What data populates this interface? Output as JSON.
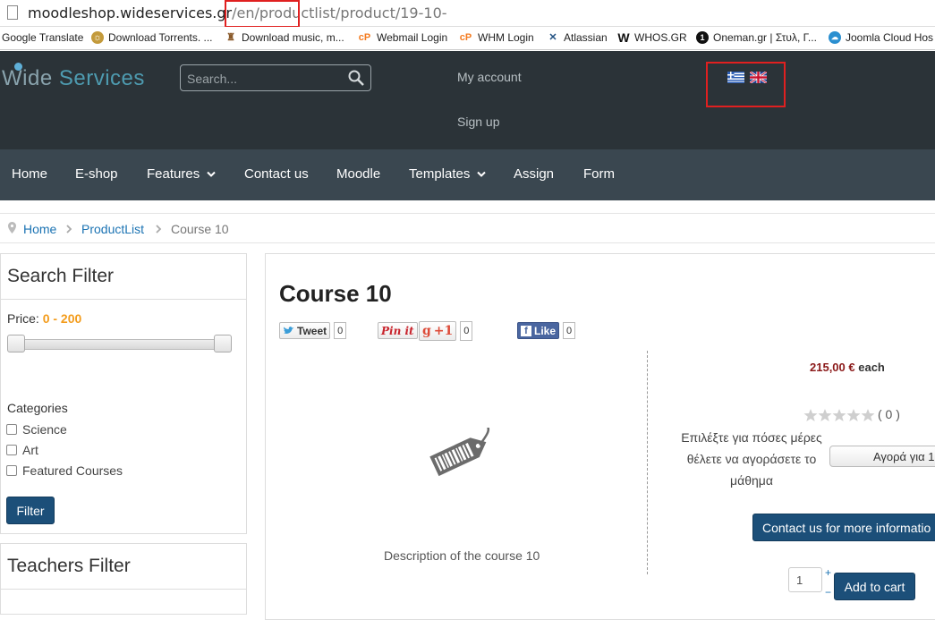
{
  "browser": {
    "url_host": "moodleshop.wideservices.gr",
    "url_path": "/en/productlist/product/19-10-",
    "bookmarks": [
      {
        "label": "Google Translate",
        "icon": "google-translate-icon"
      },
      {
        "label": "Download Torrents. ...",
        "icon": "torrent-icon"
      },
      {
        "label": "Download music, m...",
        "icon": "music-icon"
      },
      {
        "label": "Webmail Login",
        "icon": "cpanel-icon"
      },
      {
        "label": "WHM Login",
        "icon": "cpanel-icon"
      },
      {
        "label": "Atlassian",
        "icon": "atlassian-icon"
      },
      {
        "label": "WHOS.GR",
        "icon": "whos-icon"
      },
      {
        "label": "Oneman.gr | Στυλ, Γ...",
        "icon": "oneman-icon"
      },
      {
        "label": "Joomla Cloud Hos",
        "icon": "cloud-icon"
      }
    ]
  },
  "header": {
    "logo_word1": "Wide",
    "logo_word2": "Services",
    "search_placeholder": "Search...",
    "my_account": "My account",
    "sign_up": "Sign up",
    "languages": [
      "greek-flag-icon",
      "uk-flag-icon"
    ]
  },
  "nav": {
    "items": [
      {
        "label": "Home",
        "dropdown": false
      },
      {
        "label": "E-shop",
        "dropdown": false
      },
      {
        "label": "Features",
        "dropdown": true
      },
      {
        "label": "Contact us",
        "dropdown": false
      },
      {
        "label": "Moodle",
        "dropdown": false
      },
      {
        "label": "Templates",
        "dropdown": true
      },
      {
        "label": "Assign",
        "dropdown": false
      },
      {
        "label": "Form",
        "dropdown": false
      }
    ]
  },
  "breadcrumb": {
    "home": "Home",
    "productlist": "ProductList",
    "current": "Course 10"
  },
  "search_filter": {
    "title": "Search Filter",
    "price_label": "Price:",
    "price_range": "0 - 200",
    "price_min": 0,
    "price_max": 200,
    "categories_label": "Categories",
    "categories": [
      "Science",
      "Art",
      "Featured Courses"
    ],
    "filter_button": "Filter"
  },
  "teachers_filter": {
    "title": "Teachers Filter"
  },
  "product": {
    "title": "Course 10",
    "tweet_label": "Tweet",
    "tweet_count": "0",
    "pinit_label": "Pin it",
    "gplus_label": "+1",
    "gplus_count": "0",
    "like_label": "Like",
    "like_count": "0",
    "description": "Description of the course 10",
    "price_amount": "215,00 €",
    "price_suffix": "each",
    "rating_text": "( 0 )",
    "rating_value": 0,
    "duration_prompt": "Επιλέξτε για πόσες μέρες θέλετε να αγοράσετε το μάθημα",
    "duration_select": "Αγορά για 1",
    "contact_button": "Contact us for more informatio",
    "quantity": "1",
    "plus": "+",
    "minus": "−",
    "add_to_cart": "Add to cart"
  },
  "colors": {
    "header_bg": "#2b3338",
    "nav_bg": "#3a4750",
    "link": "#1b73b3",
    "price_range": "#f39c1c",
    "button": "#1c4f79",
    "highlight": "#e02020"
  }
}
